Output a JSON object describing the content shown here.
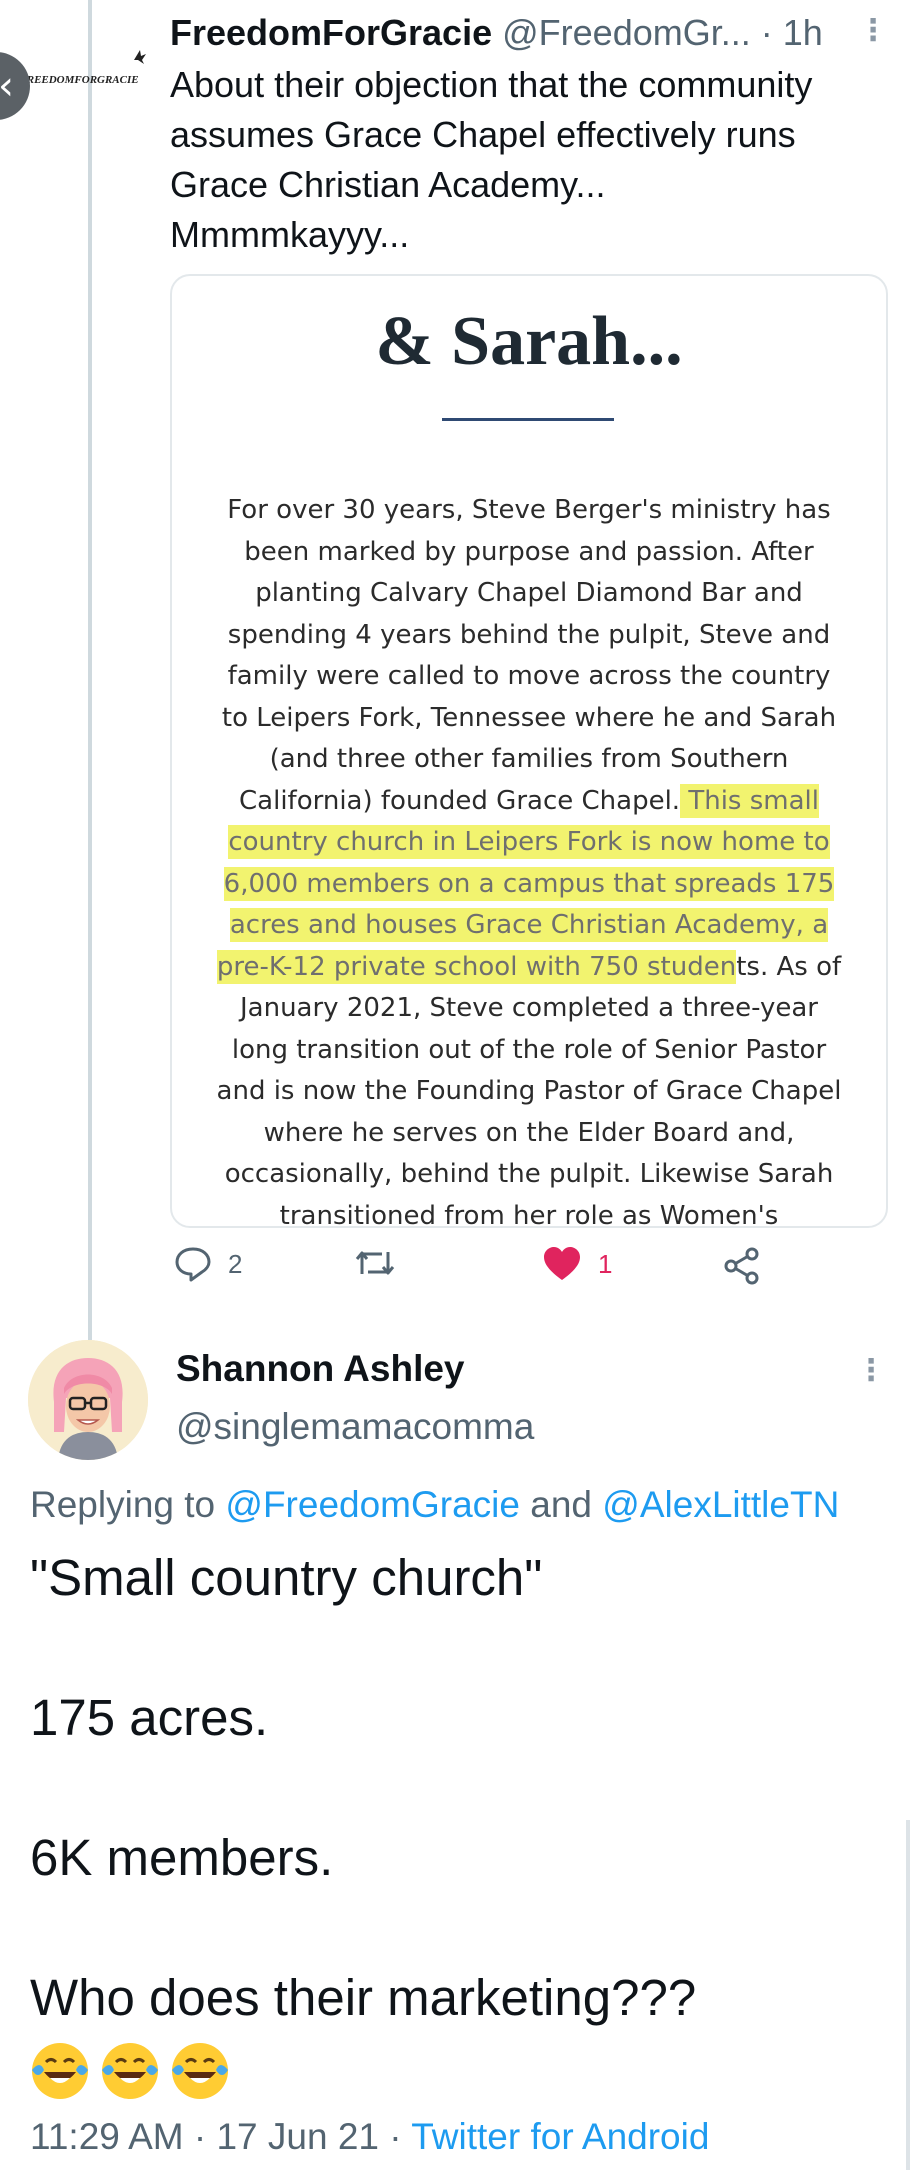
{
  "tweet": {
    "display_name": "FreedomForGracie",
    "handle": "@FreedomGr...",
    "separator": "·",
    "time": "1h",
    "avatar_text": "FREEDOMFORGRACIE",
    "text_lines": [
      "About their objection that the community",
      "assumes Grace Chapel effectively runs",
      "Grace Christian Academy...",
      "Mmmmkayyy..."
    ],
    "card": {
      "heading": "& Sarah...",
      "body_before": "For over 30 years, Steve Berger's ministry has been marked by purpose and passion. After planting Calvary Chapel Diamond Bar and spending 4 years behind the pulpit, Steve and family were called to move across the country to Leipers Fork, Tennessee where he and Sarah (and three other families from Southern California) founded Grace Chapel.",
      "body_highlight": " This small country church in Leipers Fork is now home to 6,000 members on a campus that spreads 175 acres and houses Grace Christian Academy, a pre-K-12 private school with 750 studen",
      "body_after": "ts. As of January 2021, Steve completed a three-year long transition out of the role of Senior Pastor and is now the Founding Pastor of Grace Chapel where he serves on the Elder Board and, occasionally, behind the pulpit. Likewise Sarah transitioned from her role as Women's",
      "highlight_color": "#eef046",
      "rule_color": "#2f4a73"
    },
    "actions": {
      "reply_count": "2",
      "like_count": "1",
      "like_color": "#e0245e"
    }
  },
  "reply": {
    "display_name": "Shannon Ashley",
    "handle": "@singlemamacomma",
    "replying_prefix": "Replying to",
    "replying_user1": "@FreedomGracie",
    "replying_and": "and",
    "replying_user2": "@AlexLittleTN",
    "lines": [
      "\"Small country church\"",
      "175 acres.",
      "6K members.",
      "Who does their marketing???"
    ],
    "emojis": [
      "laughing-crying",
      "laughing-crying",
      "laughing-crying"
    ],
    "time": "11:29 AM",
    "date": "17 Jun 21",
    "source": "Twitter for Android"
  },
  "colors": {
    "link": "#1d9bf0",
    "secondary_text": "#536471",
    "primary_text": "#0f1419"
  }
}
